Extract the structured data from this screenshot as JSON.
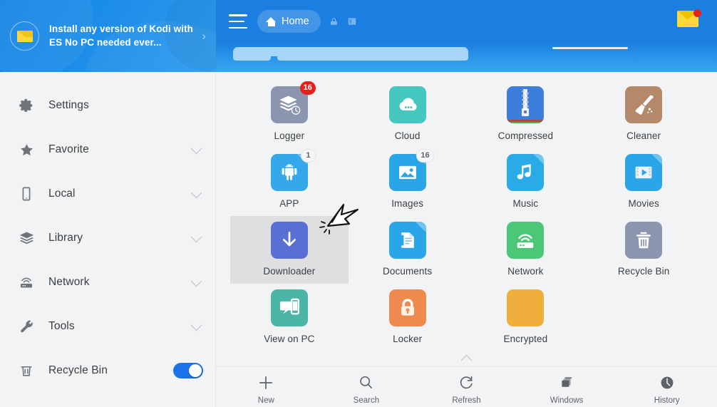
{
  "sidebar": {
    "promo": {
      "icon": "envelope-icon",
      "text": "Install any version of Kodi with ES No PC needed ever...",
      "arrow": "›"
    },
    "items": [
      {
        "id": "settings",
        "icon": "gear-icon",
        "label": "Settings",
        "chevron": false,
        "toggle": null
      },
      {
        "id": "favorite",
        "icon": "star-icon",
        "label": "Favorite",
        "chevron": true,
        "toggle": null
      },
      {
        "id": "local",
        "icon": "phone-icon",
        "label": "Local",
        "chevron": true,
        "toggle": null
      },
      {
        "id": "library",
        "icon": "layers-icon",
        "label": "Library",
        "chevron": true,
        "toggle": null
      },
      {
        "id": "network",
        "icon": "router-icon",
        "label": "Network",
        "chevron": true,
        "toggle": null
      },
      {
        "id": "tools",
        "icon": "wrench-icon",
        "label": "Tools",
        "chevron": true,
        "toggle": null
      },
      {
        "id": "recycle-bin",
        "icon": "trash-icon",
        "label": "Recycle Bin",
        "chevron": false,
        "toggle": "on"
      }
    ]
  },
  "topbar": {
    "menu_icon": "hamburger-icon",
    "breadcrumb": "Home",
    "breadcrumb_icon": "home-icon",
    "extra_icons": [
      "lock-icon",
      "window-icon"
    ],
    "mail_icon": "mail-icon",
    "mail_badge": true,
    "accent": "#1a7fe0"
  },
  "grid": {
    "items": [
      {
        "name": "Logger",
        "icon": "logger-icon",
        "badge": "16",
        "badge_style": "red",
        "color": "#8b95ad",
        "selected": false
      },
      {
        "name": "Cloud",
        "icon": "cloud-icon",
        "badge": null,
        "badge_style": null,
        "color": "#45c7c0",
        "selected": false
      },
      {
        "name": "Compressed",
        "icon": "zip-icon",
        "badge": null,
        "badge_style": null,
        "color": "#3d7ddb",
        "selected": false
      },
      {
        "name": "Cleaner",
        "icon": "broom-icon",
        "badge": null,
        "badge_style": null,
        "color": "#b5886a",
        "selected": false
      },
      {
        "name": "APP",
        "icon": "android-icon",
        "badge": "1",
        "badge_style": "light",
        "color": "#34a8e8",
        "selected": false
      },
      {
        "name": "Images",
        "icon": "image-icon",
        "badge": "16",
        "badge_style": "light",
        "color": "#2aa6e8",
        "selected": false
      },
      {
        "name": "Music",
        "icon": "music-icon",
        "badge": null,
        "badge_style": null,
        "color": "#2aabe8",
        "selected": false
      },
      {
        "name": "Movies",
        "icon": "movie-icon",
        "badge": null,
        "badge_style": null,
        "color": "#2aa6e8",
        "selected": false
      },
      {
        "name": "Downloader",
        "icon": "download-icon",
        "badge": null,
        "badge_style": null,
        "color": "#5a6fd4",
        "selected": true
      },
      {
        "name": "Documents",
        "icon": "document-icon",
        "badge": null,
        "badge_style": null,
        "color": "#2aa6e8",
        "selected": false
      },
      {
        "name": "Network",
        "icon": "router-icon",
        "badge": null,
        "badge_style": null,
        "color": "#4cc677",
        "selected": false
      },
      {
        "name": "Recycle Bin",
        "icon": "trash-icon",
        "badge": null,
        "badge_style": null,
        "color": "#8b95ad",
        "selected": false
      },
      {
        "name": "View on PC",
        "icon": "view-on-pc-icon",
        "badge": null,
        "badge_style": null,
        "color": "#4bb5a6",
        "selected": false
      },
      {
        "name": "Locker",
        "icon": "padlock-icon",
        "badge": null,
        "badge_style": null,
        "color": "#ed8b4e",
        "selected": false
      },
      {
        "name": "Encrypted",
        "icon": "keyhole-icon",
        "badge": null,
        "badge_style": null,
        "color": "#f0ae3c",
        "selected": false
      }
    ]
  },
  "bottombar": {
    "collapse_icon": "caret-up-icon",
    "items": [
      {
        "id": "new",
        "icon": "plus-icon",
        "label": "New"
      },
      {
        "id": "search",
        "icon": "search-icon",
        "label": "Search"
      },
      {
        "id": "refresh",
        "icon": "refresh-icon",
        "label": "Refresh"
      },
      {
        "id": "windows",
        "icon": "windows-icon",
        "label": "Windows"
      },
      {
        "id": "history",
        "icon": "clock-icon",
        "label": "History"
      }
    ]
  },
  "cursor": {
    "icon": "click-cursor-icon"
  }
}
